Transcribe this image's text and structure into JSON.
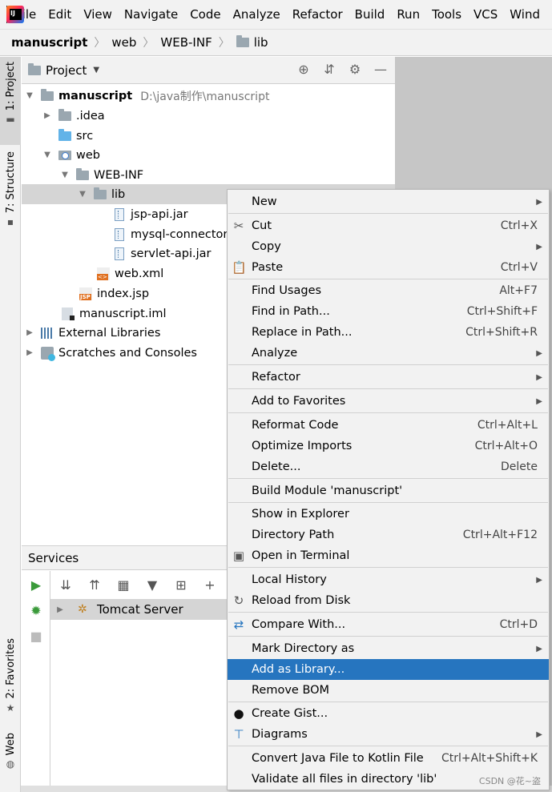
{
  "menubar": {
    "items": [
      "File",
      "Edit",
      "View",
      "Navigate",
      "Code",
      "Analyze",
      "Refactor",
      "Build",
      "Run",
      "Tools",
      "VCS",
      "Wind"
    ]
  },
  "breadcrumb": {
    "items": [
      "manuscript",
      "web",
      "WEB-INF",
      "lib"
    ]
  },
  "left_strip": {
    "project": "1: Project",
    "structure": "7: Structure",
    "favorites": "2: Favorites",
    "web": "Web"
  },
  "project_panel": {
    "title": "Project",
    "tree": [
      {
        "label": "manuscript",
        "hint": "D:\\java制作\\manuscript"
      },
      {
        "label": ".idea"
      },
      {
        "label": "src"
      },
      {
        "label": "web"
      },
      {
        "label": "WEB-INF"
      },
      {
        "label": "lib"
      },
      {
        "label": "jsp-api.jar"
      },
      {
        "label": "mysql-connector-"
      },
      {
        "label": "servlet-api.jar"
      },
      {
        "label": "web.xml"
      },
      {
        "label": "index.jsp"
      },
      {
        "label": "manuscript.iml"
      },
      {
        "label": "External Libraries"
      },
      {
        "label": "Scratches and Consoles"
      }
    ]
  },
  "services": {
    "title": "Services",
    "server": "Tomcat Server"
  },
  "context_menu": {
    "items": [
      {
        "label": "New",
        "shortcut": ""
      },
      {
        "label": "Cut",
        "shortcut": "Ctrl+X"
      },
      {
        "label": "Copy",
        "shortcut": ""
      },
      {
        "label": "Paste",
        "shortcut": "Ctrl+V"
      },
      {
        "label": "Find Usages",
        "shortcut": "Alt+F7"
      },
      {
        "label": "Find in Path...",
        "shortcut": "Ctrl+Shift+F"
      },
      {
        "label": "Replace in Path...",
        "shortcut": "Ctrl+Shift+R"
      },
      {
        "label": "Analyze",
        "shortcut": ""
      },
      {
        "label": "Refactor",
        "shortcut": ""
      },
      {
        "label": "Add to Favorites",
        "shortcut": ""
      },
      {
        "label": "Reformat Code",
        "shortcut": "Ctrl+Alt+L"
      },
      {
        "label": "Optimize Imports",
        "shortcut": "Ctrl+Alt+O"
      },
      {
        "label": "Delete...",
        "shortcut": "Delete"
      },
      {
        "label": "Build Module 'manuscript'",
        "shortcut": ""
      },
      {
        "label": "Show in Explorer",
        "shortcut": ""
      },
      {
        "label": "Directory Path",
        "shortcut": "Ctrl+Alt+F12"
      },
      {
        "label": "Open in Terminal",
        "shortcut": ""
      },
      {
        "label": "Local History",
        "shortcut": ""
      },
      {
        "label": "Reload from Disk",
        "shortcut": ""
      },
      {
        "label": "Compare With...",
        "shortcut": "Ctrl+D"
      },
      {
        "label": "Mark Directory as",
        "shortcut": ""
      },
      {
        "label": "Add as Library...",
        "shortcut": ""
      },
      {
        "label": "Remove BOM",
        "shortcut": ""
      },
      {
        "label": "Create Gist...",
        "shortcut": ""
      },
      {
        "label": "Diagrams",
        "shortcut": ""
      },
      {
        "label": "Convert Java File to Kotlin File",
        "shortcut": "Ctrl+Alt+Shift+K"
      },
      {
        "label": "Validate all files in directory 'lib'",
        "shortcut": ""
      }
    ]
  },
  "watermark": "CSDN @花~盗",
  "colors": {
    "menu_highlight": "#2675bf",
    "selection_grey": "#d5d5d5",
    "panel_bg": "#f2f2f2"
  }
}
